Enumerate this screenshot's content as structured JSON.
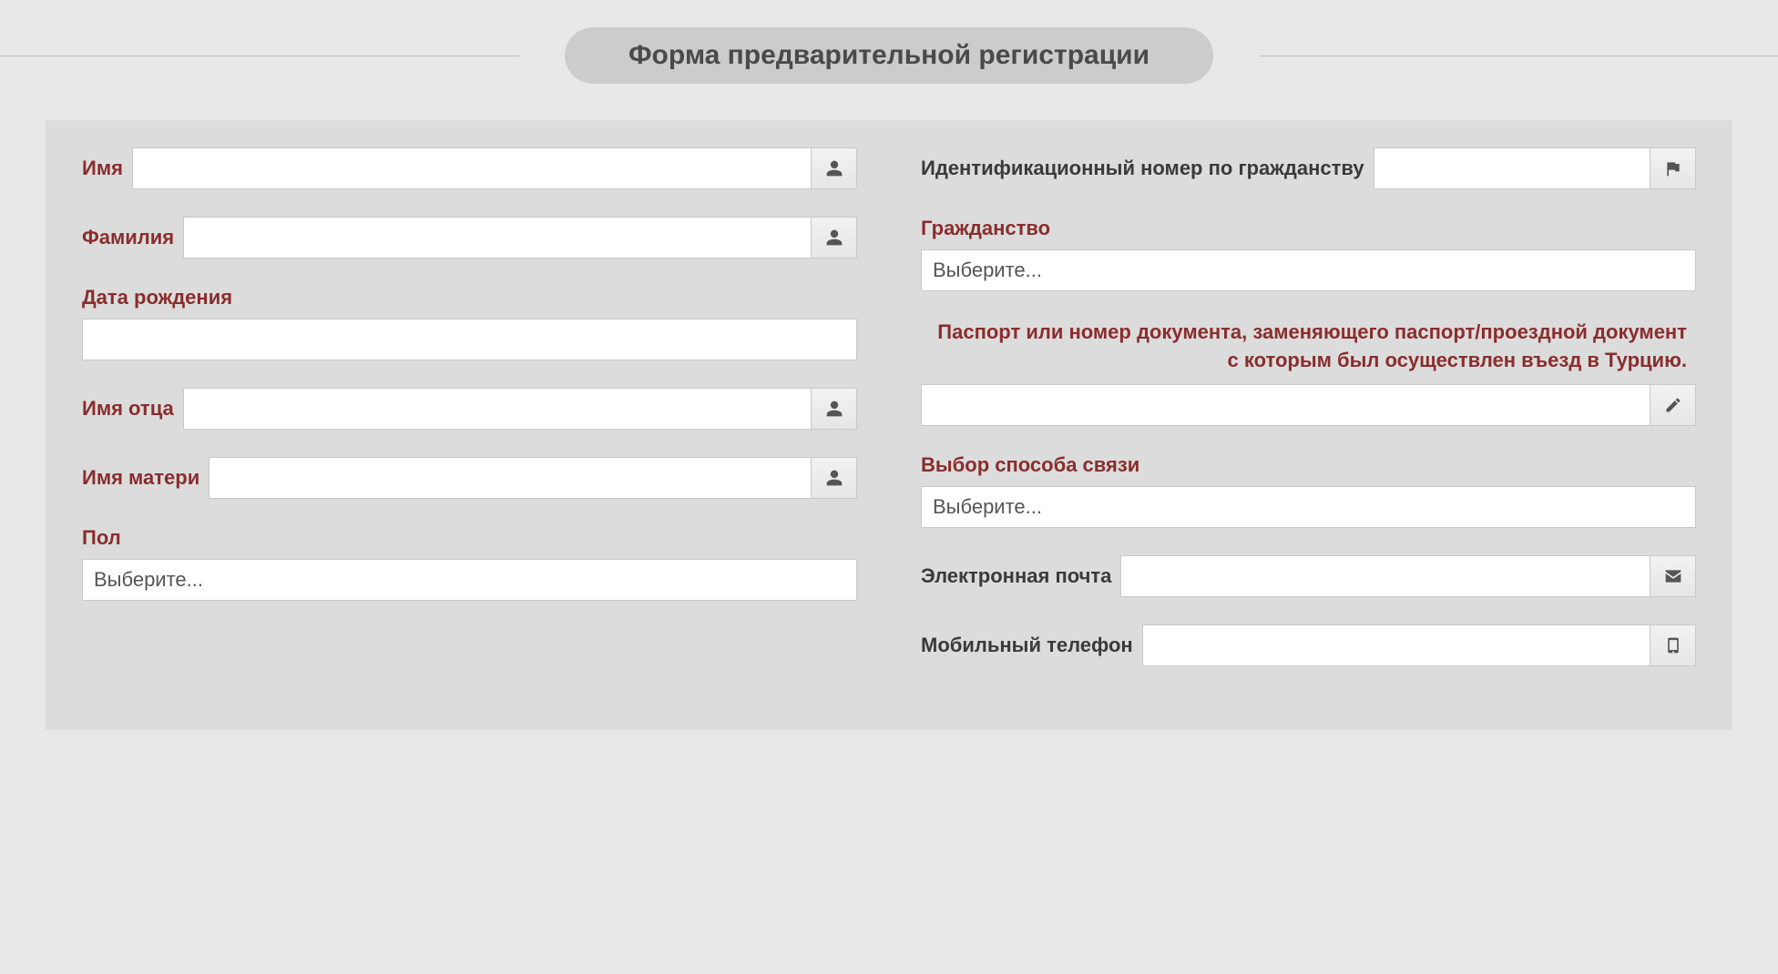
{
  "header": {
    "title": "Форма предварительной регистрации"
  },
  "left": {
    "name": {
      "label": "Имя"
    },
    "surname": {
      "label": "Фамилия"
    },
    "birthdate": {
      "label": "Дата рождения"
    },
    "father": {
      "label": "Имя отца"
    },
    "mother": {
      "label": "Имя матери"
    },
    "gender": {
      "label": "Пол",
      "placeholder": "Выберите..."
    }
  },
  "right": {
    "idnumber": {
      "label": "Идентификационный номер по гражданству"
    },
    "citizenship": {
      "label": "Гражданство",
      "placeholder": "Выберите..."
    },
    "passport": {
      "label": "Паспорт или номер документа, заменяющего паспорт/проездной документ с которым был осуществлен въезд в Турцию."
    },
    "contact_method": {
      "label": "Выбор способа связи",
      "placeholder": "Выберите..."
    },
    "email": {
      "label": "Электронная почта"
    },
    "phone": {
      "label": "Мобильный телефон"
    }
  }
}
